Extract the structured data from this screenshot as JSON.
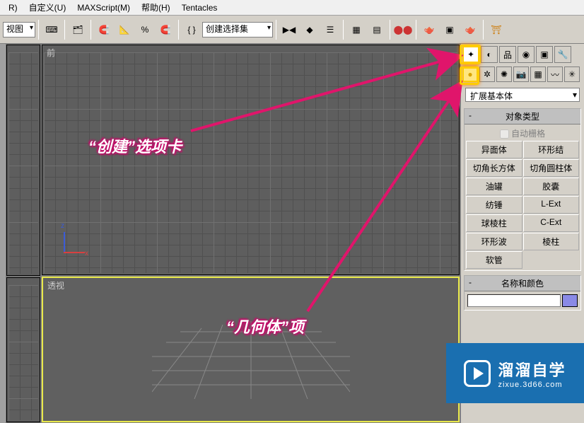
{
  "menu": {
    "r": "R)",
    "customize": "自定义(U)",
    "maxscript": "MAXScript(M)",
    "help": "帮助(H)",
    "tentacles": "Tentacles"
  },
  "toolbar": {
    "view_dd": "视图",
    "selection_set": "创建选择集"
  },
  "viewports": {
    "front_label": "前",
    "persp_label": "透视",
    "axis_z": "z",
    "axis_x": "x"
  },
  "command_panel": {
    "category_dd": "扩展基本体",
    "object_type_hdr": "对象类型",
    "auto_grid": "自动栅格",
    "name_color_hdr": "名称和颜色",
    "buttons": [
      "异面体",
      "环形结",
      "切角长方体",
      "切角圆柱体",
      "油罐",
      "胶囊",
      "纺锤",
      "L-Ext",
      "球棱柱",
      "C-Ext",
      "环形波",
      "棱柱",
      "软管",
      ""
    ]
  },
  "annotations": {
    "create_tab": "“创建”选项卡",
    "geometry": "“几何体”项"
  },
  "watermark": {
    "title": "溜溜自学",
    "sub": "zixue.3d66.com"
  },
  "icons": {
    "create": "✦",
    "modify": "◐",
    "hierarchy": "品",
    "motion": "◉",
    "display": "▣",
    "utilities": "🔧",
    "geometry": "●",
    "shapes": "✲",
    "lights": "✺",
    "cameras": "📷",
    "helpers": "▦",
    "space": "〰",
    "systems": "✳"
  }
}
